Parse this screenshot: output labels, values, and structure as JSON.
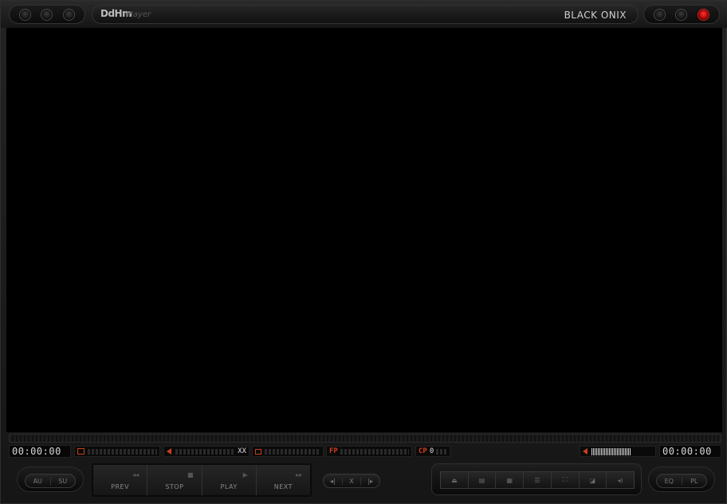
{
  "window": {
    "logo": "DdHm",
    "logo_sub": "Player",
    "skin_name": "BLACK ONIX"
  },
  "status": {
    "time_elapsed": "00:00:00",
    "time_total": "00:00:00",
    "vol_indicator": "XX",
    "fp_label": "FP",
    "cp_label": "CP",
    "cp_value": "0"
  },
  "controls": {
    "left_pill": [
      "AU",
      "SU"
    ],
    "transport": [
      {
        "label": "PREV",
        "icon": "prev-icon"
      },
      {
        "label": "STOP",
        "icon": "stop-icon"
      },
      {
        "label": "PLAY",
        "icon": "play-icon"
      },
      {
        "label": "NEXT",
        "icon": "next-icon"
      }
    ],
    "nav_pill": [
      "◂|",
      "X",
      "|▸"
    ],
    "right_pill": [
      "EQ",
      "PL"
    ],
    "tools": [
      "eject-icon",
      "file-icon",
      "layers-icon",
      "settings-icon",
      "fullscreen-icon",
      "minimode-icon",
      "audio-icon"
    ]
  }
}
